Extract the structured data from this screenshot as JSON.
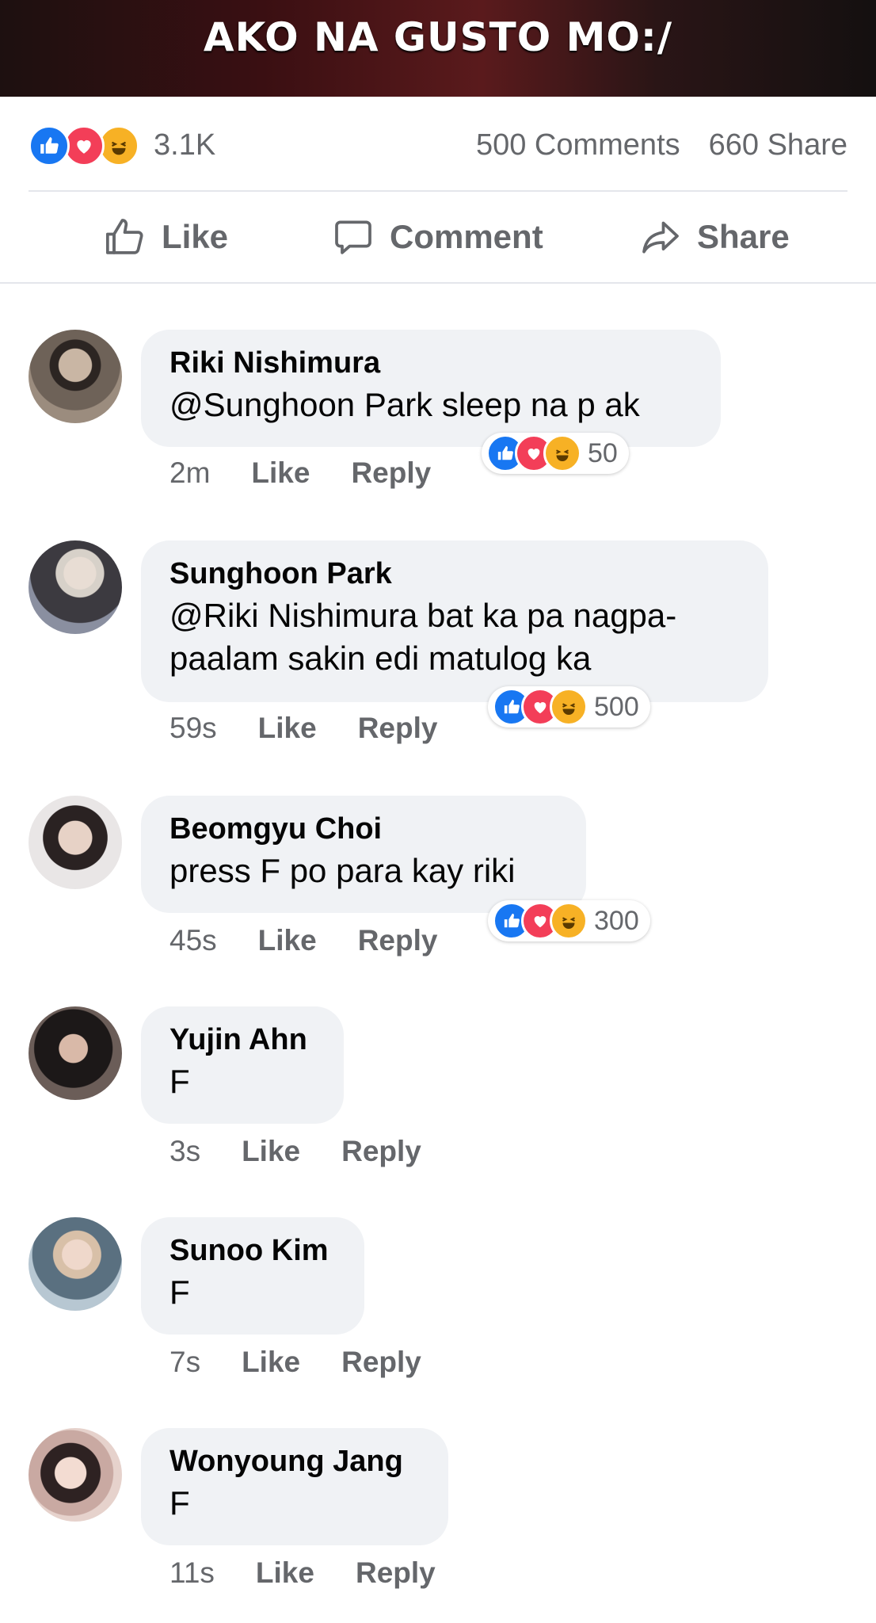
{
  "post": {
    "image_caption": "AKO NA GUSTO MO:/",
    "reaction_total": "3.1K",
    "comments_count": "500 Comments",
    "shares_count": "660 Share"
  },
  "actions": {
    "like": "Like",
    "comment": "Comment",
    "share": "Share"
  },
  "comments": [
    {
      "name": "Riki Nishimura",
      "text": "@Sunghoon Park sleep na p ak",
      "time": "2m",
      "like": "Like",
      "reply": "Reply",
      "reactions": "50"
    },
    {
      "name": "Sunghoon Park",
      "text": "@Riki Nishimura bat ka pa nagpa-paalam sakin edi matulog ka",
      "time": "59s",
      "like": "Like",
      "reply": "Reply",
      "reactions": "500"
    },
    {
      "name": "Beomgyu Choi",
      "text": "press F po para kay riki",
      "time": "45s",
      "like": "Like",
      "reply": "Reply",
      "reactions": "300"
    },
    {
      "name": "Yujin Ahn",
      "text": "F",
      "time": "3s",
      "like": "Like",
      "reply": "Reply"
    },
    {
      "name": "Sunoo Kim",
      "text": "F",
      "time": "7s",
      "like": "Like",
      "reply": "Reply"
    },
    {
      "name": "Wonyoung Jang",
      "text": "F",
      "time": "11s",
      "like": "Like",
      "reply": "Reply"
    }
  ],
  "icons": {
    "like_reaction": "thumbs-up-icon",
    "love_reaction": "heart-icon",
    "haha_reaction": "laughing-face-icon"
  },
  "colors": {
    "like_blue": "#1877f2",
    "love_red": "#f33e58",
    "haha_yellow": "#f7b125",
    "secondary_text": "#65676b",
    "bubble_bg": "#f0f2f5"
  }
}
